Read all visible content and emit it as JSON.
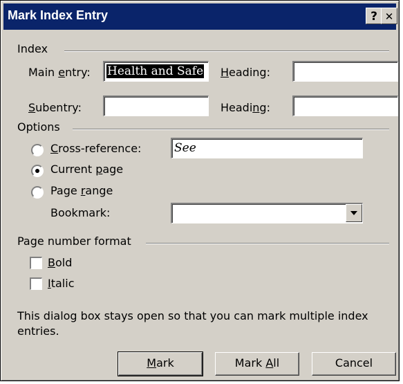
{
  "dialog": {
    "title": "Mark Index Entry",
    "help_button": "?",
    "close_button": "✕"
  },
  "index": {
    "section_label": "Index",
    "main_entry_label": "Main entry:",
    "main_entry_value": "Health and Safe",
    "heading_label_1": "Heading:",
    "heading_value_1": "",
    "subentry_label": "Subentry:",
    "subentry_value": "",
    "heading_label_2": "Heading:",
    "heading_value_2": ""
  },
  "options": {
    "section_label": "Options",
    "cross_reference_label": "Cross-reference:",
    "cross_reference_value": "See",
    "current_page_label": "Current page",
    "page_range_label": "Page range",
    "bookmark_label": "Bookmark:",
    "bookmark_value": "",
    "selected": "current_page"
  },
  "page_number_format": {
    "section_label": "Page number format",
    "bold_label": "Bold",
    "bold_checked": false,
    "italic_label": "Italic",
    "italic_checked": false
  },
  "info_text": "This dialog box stays open so that you can mark multiple index entries.",
  "buttons": {
    "mark": "Mark",
    "mark_all": "Mark All",
    "cancel": "Cancel"
  }
}
